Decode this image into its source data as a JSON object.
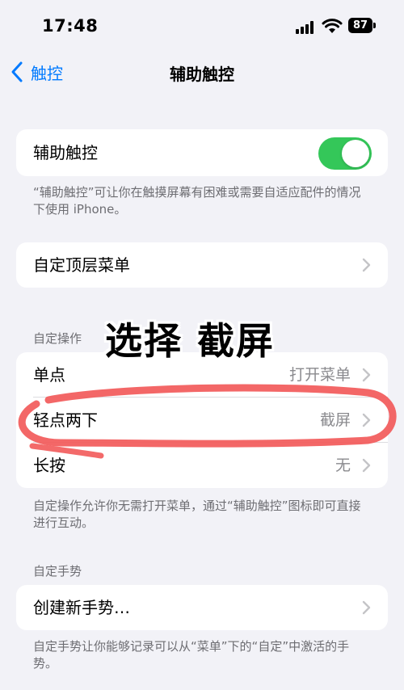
{
  "status_bar": {
    "time": "17:48",
    "battery": "87"
  },
  "nav": {
    "back_label": "触控",
    "title": "辅助触控"
  },
  "assistive_touch": {
    "label": "辅助触控",
    "enabled": true,
    "footnote": "“辅助触控”可让你在触摸屏幕有困难或需要自适应配件的情况下使用 iPhone。"
  },
  "customize_menu": {
    "label": "自定顶层菜单"
  },
  "custom_actions": {
    "header": "自定操作",
    "rows": [
      {
        "label": "单点",
        "value": "打开菜单"
      },
      {
        "label": "轻点两下",
        "value": "截屏"
      },
      {
        "label": "长按",
        "value": "无"
      }
    ],
    "footnote": "自定操作允许你无需打开菜单，通过“辅助触控”图标即可直接进行互动。"
  },
  "custom_gestures": {
    "header": "自定手势",
    "create_label": "创建新手势…",
    "footnote": "自定手势让你能够记录可以从“菜单”下的“自定”中激活的手势。"
  },
  "overlay": {
    "text": "选择 截屏"
  },
  "colors": {
    "accent": "#007aff",
    "toggle_on": "#34c759",
    "annotation": "#f25a5a"
  }
}
